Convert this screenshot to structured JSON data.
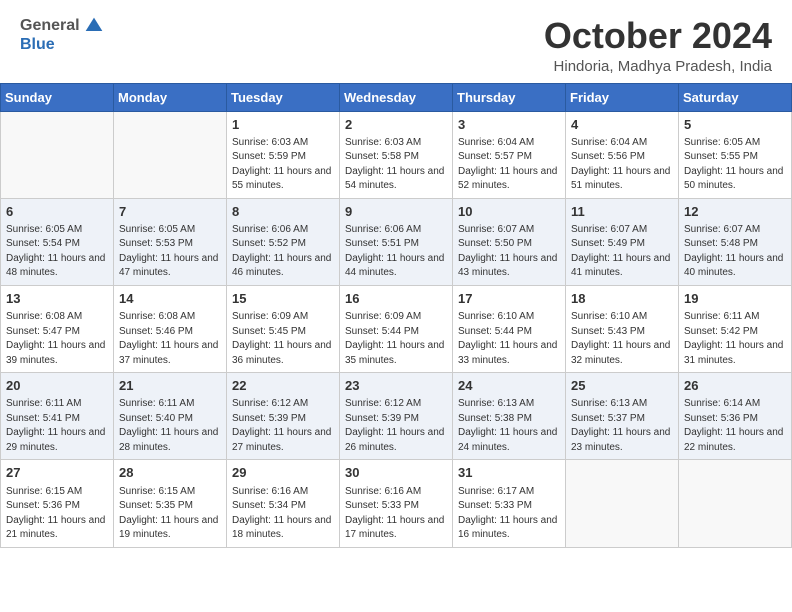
{
  "header": {
    "logo_general": "General",
    "logo_blue": "Blue",
    "month_title": "October 2024",
    "location": "Hindoria, Madhya Pradesh, India"
  },
  "days_of_week": [
    "Sunday",
    "Monday",
    "Tuesday",
    "Wednesday",
    "Thursday",
    "Friday",
    "Saturday"
  ],
  "weeks": [
    [
      {
        "day": "",
        "info": ""
      },
      {
        "day": "",
        "info": ""
      },
      {
        "day": "1",
        "info": "Sunrise: 6:03 AM\nSunset: 5:59 PM\nDaylight: 11 hours and 55 minutes."
      },
      {
        "day": "2",
        "info": "Sunrise: 6:03 AM\nSunset: 5:58 PM\nDaylight: 11 hours and 54 minutes."
      },
      {
        "day": "3",
        "info": "Sunrise: 6:04 AM\nSunset: 5:57 PM\nDaylight: 11 hours and 52 minutes."
      },
      {
        "day": "4",
        "info": "Sunrise: 6:04 AM\nSunset: 5:56 PM\nDaylight: 11 hours and 51 minutes."
      },
      {
        "day": "5",
        "info": "Sunrise: 6:05 AM\nSunset: 5:55 PM\nDaylight: 11 hours and 50 minutes."
      }
    ],
    [
      {
        "day": "6",
        "info": "Sunrise: 6:05 AM\nSunset: 5:54 PM\nDaylight: 11 hours and 48 minutes."
      },
      {
        "day": "7",
        "info": "Sunrise: 6:05 AM\nSunset: 5:53 PM\nDaylight: 11 hours and 47 minutes."
      },
      {
        "day": "8",
        "info": "Sunrise: 6:06 AM\nSunset: 5:52 PM\nDaylight: 11 hours and 46 minutes."
      },
      {
        "day": "9",
        "info": "Sunrise: 6:06 AM\nSunset: 5:51 PM\nDaylight: 11 hours and 44 minutes."
      },
      {
        "day": "10",
        "info": "Sunrise: 6:07 AM\nSunset: 5:50 PM\nDaylight: 11 hours and 43 minutes."
      },
      {
        "day": "11",
        "info": "Sunrise: 6:07 AM\nSunset: 5:49 PM\nDaylight: 11 hours and 41 minutes."
      },
      {
        "day": "12",
        "info": "Sunrise: 6:07 AM\nSunset: 5:48 PM\nDaylight: 11 hours and 40 minutes."
      }
    ],
    [
      {
        "day": "13",
        "info": "Sunrise: 6:08 AM\nSunset: 5:47 PM\nDaylight: 11 hours and 39 minutes."
      },
      {
        "day": "14",
        "info": "Sunrise: 6:08 AM\nSunset: 5:46 PM\nDaylight: 11 hours and 37 minutes."
      },
      {
        "day": "15",
        "info": "Sunrise: 6:09 AM\nSunset: 5:45 PM\nDaylight: 11 hours and 36 minutes."
      },
      {
        "day": "16",
        "info": "Sunrise: 6:09 AM\nSunset: 5:44 PM\nDaylight: 11 hours and 35 minutes."
      },
      {
        "day": "17",
        "info": "Sunrise: 6:10 AM\nSunset: 5:44 PM\nDaylight: 11 hours and 33 minutes."
      },
      {
        "day": "18",
        "info": "Sunrise: 6:10 AM\nSunset: 5:43 PM\nDaylight: 11 hours and 32 minutes."
      },
      {
        "day": "19",
        "info": "Sunrise: 6:11 AM\nSunset: 5:42 PM\nDaylight: 11 hours and 31 minutes."
      }
    ],
    [
      {
        "day": "20",
        "info": "Sunrise: 6:11 AM\nSunset: 5:41 PM\nDaylight: 11 hours and 29 minutes."
      },
      {
        "day": "21",
        "info": "Sunrise: 6:11 AM\nSunset: 5:40 PM\nDaylight: 11 hours and 28 minutes."
      },
      {
        "day": "22",
        "info": "Sunrise: 6:12 AM\nSunset: 5:39 PM\nDaylight: 11 hours and 27 minutes."
      },
      {
        "day": "23",
        "info": "Sunrise: 6:12 AM\nSunset: 5:39 PM\nDaylight: 11 hours and 26 minutes."
      },
      {
        "day": "24",
        "info": "Sunrise: 6:13 AM\nSunset: 5:38 PM\nDaylight: 11 hours and 24 minutes."
      },
      {
        "day": "25",
        "info": "Sunrise: 6:13 AM\nSunset: 5:37 PM\nDaylight: 11 hours and 23 minutes."
      },
      {
        "day": "26",
        "info": "Sunrise: 6:14 AM\nSunset: 5:36 PM\nDaylight: 11 hours and 22 minutes."
      }
    ],
    [
      {
        "day": "27",
        "info": "Sunrise: 6:15 AM\nSunset: 5:36 PM\nDaylight: 11 hours and 21 minutes."
      },
      {
        "day": "28",
        "info": "Sunrise: 6:15 AM\nSunset: 5:35 PM\nDaylight: 11 hours and 19 minutes."
      },
      {
        "day": "29",
        "info": "Sunrise: 6:16 AM\nSunset: 5:34 PM\nDaylight: 11 hours and 18 minutes."
      },
      {
        "day": "30",
        "info": "Sunrise: 6:16 AM\nSunset: 5:33 PM\nDaylight: 11 hours and 17 minutes."
      },
      {
        "day": "31",
        "info": "Sunrise: 6:17 AM\nSunset: 5:33 PM\nDaylight: 11 hours and 16 minutes."
      },
      {
        "day": "",
        "info": ""
      },
      {
        "day": "",
        "info": ""
      }
    ]
  ]
}
